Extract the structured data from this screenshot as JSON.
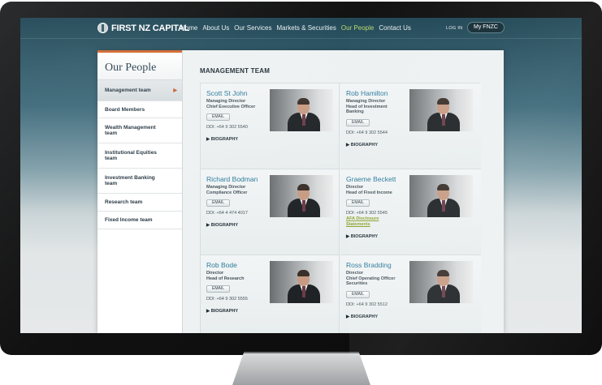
{
  "header": {
    "logo_text": "FIRST NZ CAPITAL",
    "nav": [
      "Home",
      "About Us",
      "Our Services",
      "Markets & Securities",
      "Our People",
      "Contact Us"
    ],
    "active_nav": "Our People",
    "login": "LOG IN",
    "myfnzc": "My FNZC"
  },
  "sidebar": {
    "title": "Our People",
    "items": [
      {
        "label": "Management team",
        "active": true
      },
      {
        "label": "Board Members"
      },
      {
        "label": "Wealth Management team"
      },
      {
        "label": "Institutional Equities team"
      },
      {
        "label": "Investment Banking team"
      },
      {
        "label": "Research team"
      },
      {
        "label": "Fixed Income team"
      }
    ]
  },
  "main": {
    "heading": "MANAGEMENT TEAM",
    "people": [
      {
        "name": "Scott St John",
        "title1": "Managing Director",
        "title2": "Chief Executive Officer",
        "email": "EMAIL",
        "ddi": "DDI: +64 9 302 5540",
        "bio": "BIOGRAPHY"
      },
      {
        "name": "Rob Hamilton",
        "title1": "Managing Director",
        "title2": "Head of Investment",
        "title3": "Banking",
        "email": "EMAIL",
        "ddi": "DDI: +64 9 302 5544",
        "bio": "BIOGRAPHY"
      },
      {
        "name": "Richard Bodman",
        "title1": "Managing Director",
        "title2": "Compliance Officer",
        "email": "EMAIL",
        "ddi": "DDI: +64 4 474 4017",
        "bio": "BIOGRAPHY"
      },
      {
        "name": "Graeme Beckett",
        "title1": "Director",
        "title2": "Head of Fixed Income",
        "email": "EMAIL",
        "ddi": "DDI: +64 9 302 5545",
        "link1": "AFA Disclosure",
        "link2": "Statements",
        "bio": "BIOGRAPHY"
      },
      {
        "name": "Rob Bode",
        "title1": "Director",
        "title2": "Head of Research",
        "email": "EMAIL",
        "ddi": "DDI: +64 9 302 5555",
        "bio": "BIOGRAPHY"
      },
      {
        "name": "Ross Bradding",
        "title1": "Director",
        "title2": "Chief Operating Officer",
        "title3": "Securities",
        "email": "EMAIL",
        "ddi": "DDI: +64 9 302 5512",
        "bio": "BIOGRAPHY"
      }
    ]
  },
  "colors": {
    "accent": "#d0662c",
    "link": "#2b7a9c",
    "active_nav": "#b7d86a",
    "disclosure_link": "#8aa32a"
  }
}
